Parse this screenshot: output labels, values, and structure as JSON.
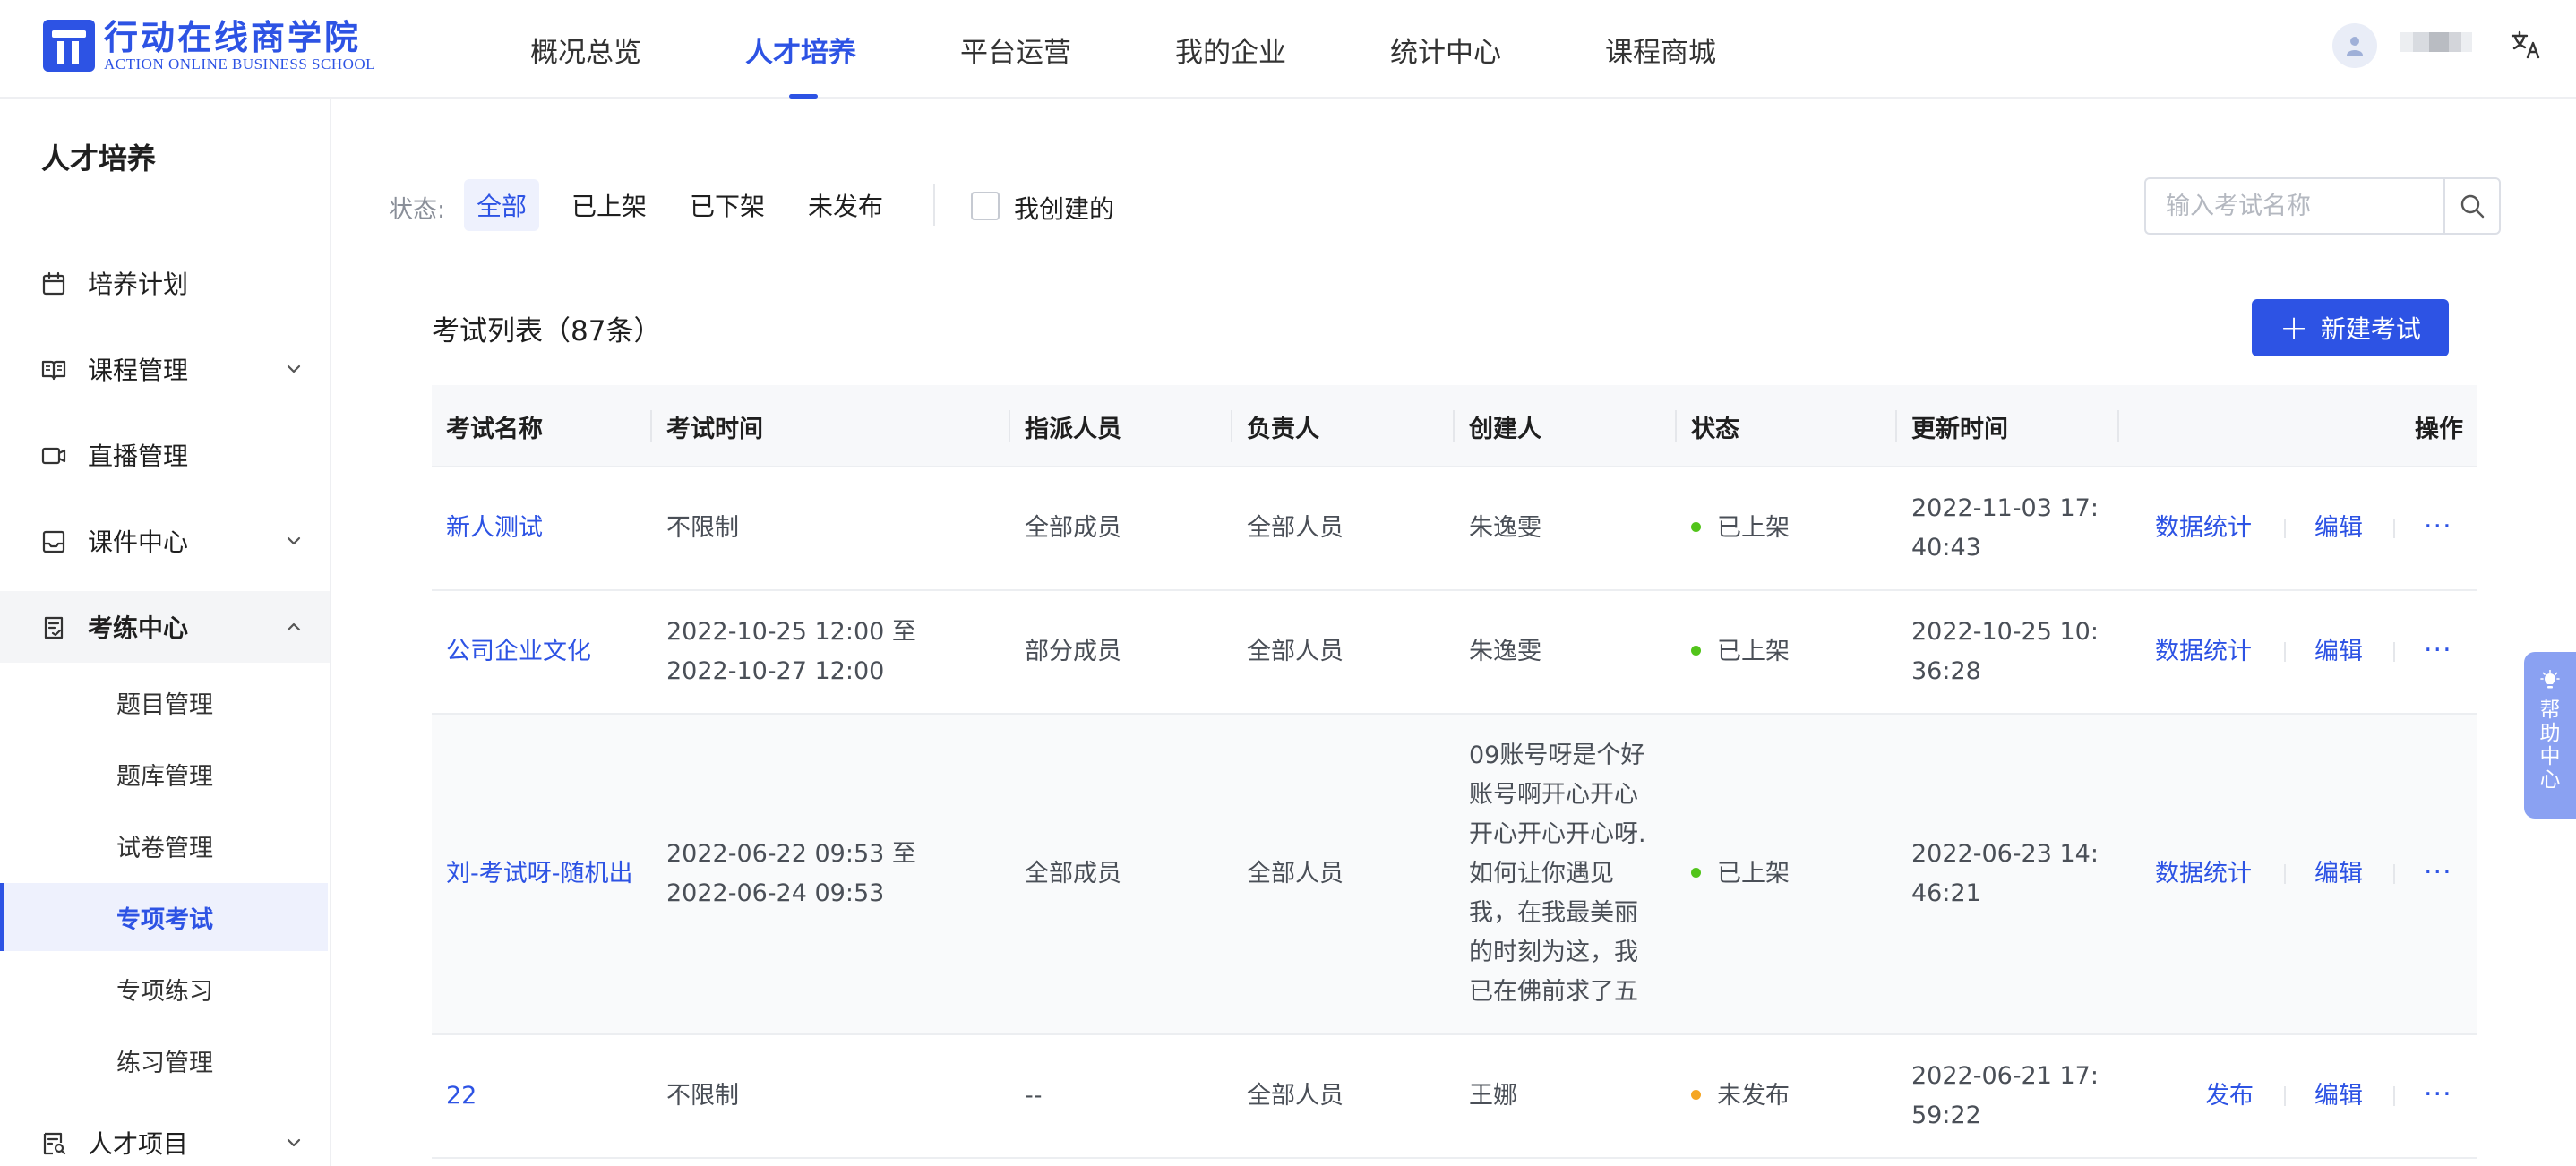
{
  "app": {
    "logo_cn": "行动在线商学院",
    "logo_en": "ACTION ONLINE BUSINESS SCHOOL"
  },
  "nav": [
    {
      "label": "概况总览",
      "active": false
    },
    {
      "label": "人才培养",
      "active": true
    },
    {
      "label": "平台运营",
      "active": false
    },
    {
      "label": "我的企业",
      "active": false
    },
    {
      "label": "统计中心",
      "active": false
    },
    {
      "label": "课程商城",
      "active": false
    }
  ],
  "header_icons": {
    "avatar": "user-avatar-icon",
    "language": "translate-icon",
    "lang_glyph": "文A"
  },
  "sidebar": {
    "title": "人才培养",
    "items": [
      {
        "label": "培养计划",
        "icon": "calendar-icon",
        "chevron": "none"
      },
      {
        "label": "课程管理",
        "icon": "book-icon",
        "chevron": "down"
      },
      {
        "label": "直播管理",
        "icon": "video-camera-icon",
        "chevron": "none"
      },
      {
        "label": "课件中心",
        "icon": "inbox-icon",
        "chevron": "down"
      },
      {
        "label": "考练中心",
        "icon": "exam-icon",
        "chevron": "up"
      },
      {
        "label": "人才项目",
        "icon": "talent-project-icon",
        "chevron": "down"
      }
    ],
    "subitems": [
      {
        "label": "题目管理",
        "active": false
      },
      {
        "label": "题库管理",
        "active": false
      },
      {
        "label": "试卷管理",
        "active": false
      },
      {
        "label": "专项考试",
        "active": true
      },
      {
        "label": "专项练习",
        "active": false
      },
      {
        "label": "练习管理",
        "active": false
      }
    ]
  },
  "filters": {
    "label": "状态:",
    "options": [
      {
        "label": "全部",
        "active": true
      },
      {
        "label": "已上架",
        "active": false
      },
      {
        "label": "已下架",
        "active": false
      },
      {
        "label": "未发布",
        "active": false
      }
    ],
    "mine_label": "我创建的",
    "mine_checked": false
  },
  "search": {
    "placeholder": "输入考试名称",
    "value": ""
  },
  "list": {
    "title": "考试列表（87条）",
    "new_button": "新建考试"
  },
  "table": {
    "columns": [
      "考试名称",
      "考试时间",
      "指派人员",
      "负责人",
      "创建人",
      "状态",
      "更新时间",
      "操作"
    ],
    "rows": [
      {
        "name": "新人测试",
        "time": "不限制",
        "assigned": "全部成员",
        "owner": "全部人员",
        "creator": "朱逸雯",
        "status": "已上架",
        "status_color": "#52c41a",
        "updated": "2022-11-03 17:40:43",
        "primary_op": "数据统计",
        "edit_op": "编辑",
        "more_op": "···"
      },
      {
        "name": "公司企业文化",
        "time": "2022-10-25 12:00 至 2022-10-27 12:00",
        "assigned": "部分成员",
        "owner": "全部人员",
        "creator": "朱逸雯",
        "status": "已上架",
        "status_color": "#52c41a",
        "updated": "2022-10-25 10:36:28",
        "primary_op": "数据统计",
        "edit_op": "编辑",
        "more_op": "···"
      },
      {
        "name": "刘-考试呀-随机出",
        "time": "2022-06-22 09:53 至 2022-06-24 09:53",
        "assigned": "全部成员",
        "owner": "全部人员",
        "creator": "09账号呀是个好账号啊开心开心开心开心开心呀.如何让你遇见我，在我最美丽的时刻为这，我已在佛前求了五",
        "status": "已上架",
        "status_color": "#52c41a",
        "updated": "2022-06-23 14:46:21",
        "primary_op": "数据统计",
        "edit_op": "编辑",
        "more_op": "···"
      },
      {
        "name": "22",
        "time": "不限制",
        "assigned": "--",
        "owner": "全部人员",
        "creator": "王娜",
        "status": "未发布",
        "status_color": "#f5a623",
        "updated": "2022-06-21 17:59:22",
        "primary_op": "发布",
        "edit_op": "编辑",
        "more_op": "···"
      }
    ]
  },
  "help": {
    "label": "帮助中心",
    "icon": "lightbulb-icon"
  },
  "colors": {
    "brand": "#2d53e4",
    "published": "#52c41a",
    "unpublished": "#f5a623"
  }
}
